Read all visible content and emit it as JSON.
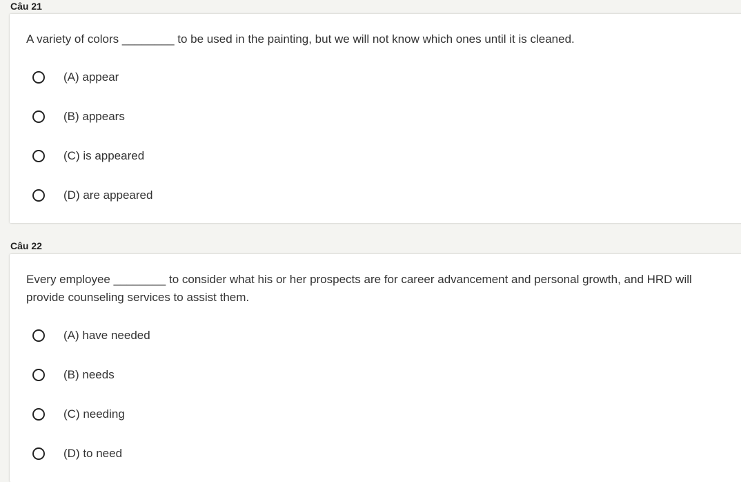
{
  "questions": [
    {
      "label": "Câu 21",
      "text": "A variety of colors ________ to be used in the painting, but we will not know which ones until it is cleaned.",
      "options": [
        "(A) appear",
        "(B) appears",
        "(C) is appeared",
        "(D) are appeared"
      ]
    },
    {
      "label": "Câu 22",
      "text": "Every employee ________ to consider what his or her prospects are for career advancement and personal growth, and HRD will provide counseling services to assist them.",
      "options": [
        "(A) have needed",
        "(B) needs",
        "(C) needing",
        "(D) to need"
      ]
    }
  ]
}
